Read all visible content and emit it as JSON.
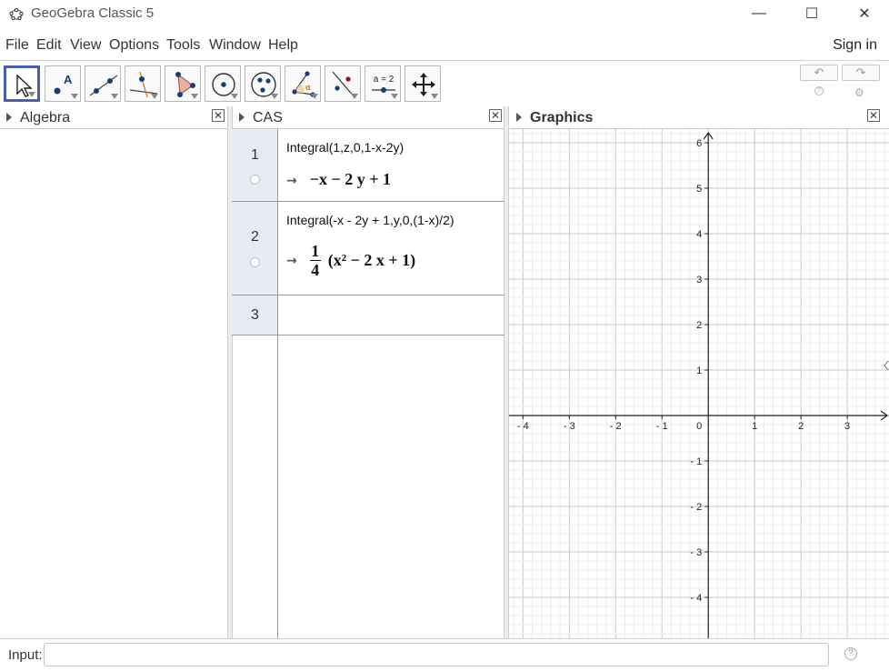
{
  "window": {
    "title": "GeoGebra Classic 5",
    "minimize": "—",
    "maximize": "☐",
    "close": "✕"
  },
  "menu": {
    "items": [
      "File",
      "Edit",
      "View",
      "Options",
      "Tools",
      "Window",
      "Help"
    ],
    "signin": "Sign in"
  },
  "toolbar": {
    "tools": [
      "move-tool",
      "point-tool",
      "line-tool",
      "perpendicular-line-tool",
      "polygon-tool",
      "circle-tool",
      "conic-tool",
      "angle-tool",
      "reflect-tool",
      "slider-tool",
      "move-graphics-view-tool"
    ],
    "slider_label": "a = 2",
    "undo": "↶",
    "redo": "↷",
    "help": "?",
    "settings": "⚙"
  },
  "panels": {
    "algebra": "Algebra",
    "cas": "CAS",
    "graphics": "Graphics",
    "close": "✕"
  },
  "cas": {
    "rows": [
      {
        "n": "1",
        "input": "Integral(1,z,0,1-x-2y)",
        "output": "−x − 2 y + 1"
      },
      {
        "n": "2",
        "input": "Integral(-x - 2y + 1,y,0,(1-x)/2)",
        "output_frac_num": "1",
        "output_frac_den": "4",
        "output_rest": "(x² − 2 x + 1)"
      },
      {
        "n": "3",
        "input": "",
        "output": ""
      }
    ],
    "arrow": "→"
  },
  "graphics": {
    "x_ticks": [
      "-4",
      "-3",
      "-2",
      "-1",
      "0",
      "1",
      "2",
      "3"
    ],
    "y_ticks": [
      "6",
      "5",
      "4",
      "3",
      "2",
      "1",
      "-1",
      "-2",
      "-3",
      "-4"
    ],
    "xlim": [
      -4.3,
      3.9
    ],
    "ylim": [
      -4.9,
      6.3
    ]
  },
  "input": {
    "label": "Input:",
    "value": "",
    "help": "?"
  }
}
